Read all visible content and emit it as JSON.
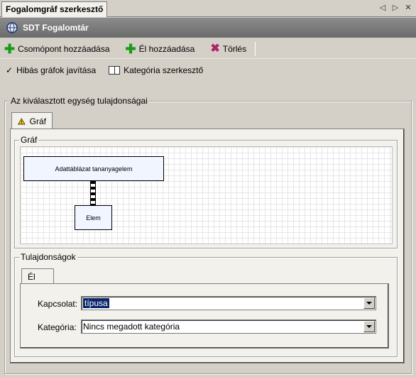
{
  "window": {
    "tab_title": "Fogalomgráf szerkesztő",
    "controls": {
      "prev": "◁",
      "next": "▷",
      "close": "✕"
    }
  },
  "header": {
    "title": "SDT Fogalomtár",
    "icon": "gear-globe-icon"
  },
  "toolbar": {
    "add_node_label": "Csomópont hozzáadása",
    "add_edge_label": "Él hozzáadása",
    "delete_label": "Törlés"
  },
  "toolbar2": {
    "fix_graphs_label": "Hibás gráfok javítása",
    "category_editor_label": "Kategória szerkesztő"
  },
  "properties_group": {
    "label": "Az kiválasztott egység tulajdonságai",
    "tab_label": "Gráf",
    "graph_group_label": "Gráf",
    "graph": {
      "nodes": [
        {
          "label": "Adattáblázat tananyagelem"
        },
        {
          "label": "Elem"
        }
      ]
    },
    "props_group_label": "Tulajdonságok",
    "props_tab_label": "Él",
    "fields": {
      "kapcsolat_label": "Kapcsolat:",
      "kapcsolat_value": "típusa",
      "kategoria_label": "Kategória:",
      "kategoria_value": "Nincs megadott kategória"
    }
  },
  "colors": {
    "header_bg": "#7a7a7a",
    "add_green": "#1a9a1a",
    "delete_magenta": "#b0246b",
    "selection": "#0a246a"
  }
}
